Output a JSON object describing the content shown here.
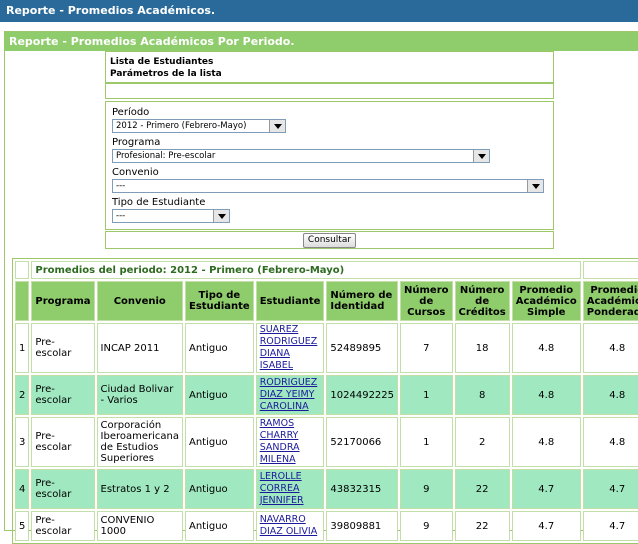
{
  "window": {
    "title": "Reporte - Promedios Académicos."
  },
  "report": {
    "header": "Reporte - Promedios Académicos Por Periodo."
  },
  "list_box": {
    "line1": "Lista de Estudiantes",
    "line2": "Parámetros de la lista"
  },
  "params": {
    "periodo": {
      "label": "Período",
      "value": "2012 - Primero (Febrero-Mayo)"
    },
    "programa": {
      "label": "Programa",
      "value": "Profesional: Pre-escolar"
    },
    "convenio": {
      "label": "Convenio",
      "value": "---"
    },
    "tipo": {
      "label": "Tipo de Estudiante",
      "value": "---"
    },
    "consultar_label": "Consultar"
  },
  "table": {
    "period_title": "Promedios del periodo: 2012 - Primero (Febrero-Mayo)",
    "headers": {
      "programa": "Programa",
      "convenio": "Convenio",
      "tipo": "Tipo de Estudiante",
      "estudiante": "Estudiante",
      "identidad": "Número de Identidad",
      "cursos": "Número de Cursos",
      "creditos": "Número de Créditos",
      "simple": "Promedio Académico Simple",
      "ponderado": "Promedio Académico Ponderado"
    },
    "rows": [
      {
        "n": "1",
        "programa": "Pre-escolar",
        "convenio": "INCAP 2011",
        "tipo": "Antiguo",
        "estudiante": "SUAREZ RODRIGUEZ DIANA ISABEL",
        "identidad": "52489895",
        "cursos": "7",
        "creditos": "18",
        "simple": "4.8",
        "ponderado": "4.8"
      },
      {
        "n": "2",
        "programa": "Pre-escolar",
        "convenio": "Ciudad Bolivar - Varios",
        "tipo": "Antiguo",
        "estudiante": "RODRIGUEZ DIAZ YEIMY CAROLINA",
        "identidad": "1024492225",
        "cursos": "1",
        "creditos": "8",
        "simple": "4.8",
        "ponderado": "4.8"
      },
      {
        "n": "3",
        "programa": "Pre-escolar",
        "convenio": "Corporación Iberoamericana de Estudios Superiores",
        "tipo": "Antiguo",
        "estudiante": "RAMOS CHARRY SANDRA MILENA",
        "identidad": "52170066",
        "cursos": "1",
        "creditos": "2",
        "simple": "4.8",
        "ponderado": "4.8"
      },
      {
        "n": "4",
        "programa": "Pre-escolar",
        "convenio": "Estratos 1 y 2",
        "tipo": "Antiguo",
        "estudiante": "LEROLLE CORREA JENNIFER",
        "identidad": "43832315",
        "cursos": "9",
        "creditos": "22",
        "simple": "4.7",
        "ponderado": "4.7"
      },
      {
        "n": "5",
        "programa": "Pre-escolar",
        "convenio": "CONVENIO 1000",
        "tipo": "Antiguo",
        "estudiante": "NAVARRO DIAZ OLIVIA",
        "identidad": "39809881",
        "cursos": "9",
        "creditos": "22",
        "simple": "4.7",
        "ponderado": "4.7"
      }
    ]
  },
  "icons": {
    "dropdown": "chevron-down-icon"
  }
}
